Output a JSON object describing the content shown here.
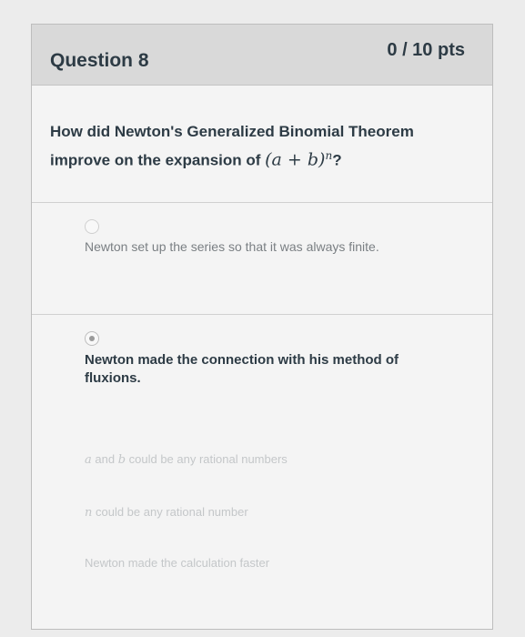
{
  "question": {
    "title": "Question 8",
    "points": "0 / 10 pts",
    "text_line1": "How did Newton's Generalized Binomial Theorem",
    "text_line2_prefix": "improve on the expansion of ",
    "text_math": "(a + b)",
    "text_exp": "n",
    "text_suffix": "?"
  },
  "answers": [
    {
      "text": "Newton set up the series so that it was always finite.",
      "selected": false
    },
    {
      "text": "Newton made the connection with his method of fluxions.",
      "selected": true
    }
  ],
  "faded_options": [
    {
      "var1": "a",
      "mid": " and ",
      "var2": "b",
      "rest": " could be any rational numbers"
    },
    {
      "var1": "n",
      "rest": " could be any rational number"
    },
    {
      "rest": "Newton made the calculation faster"
    }
  ]
}
